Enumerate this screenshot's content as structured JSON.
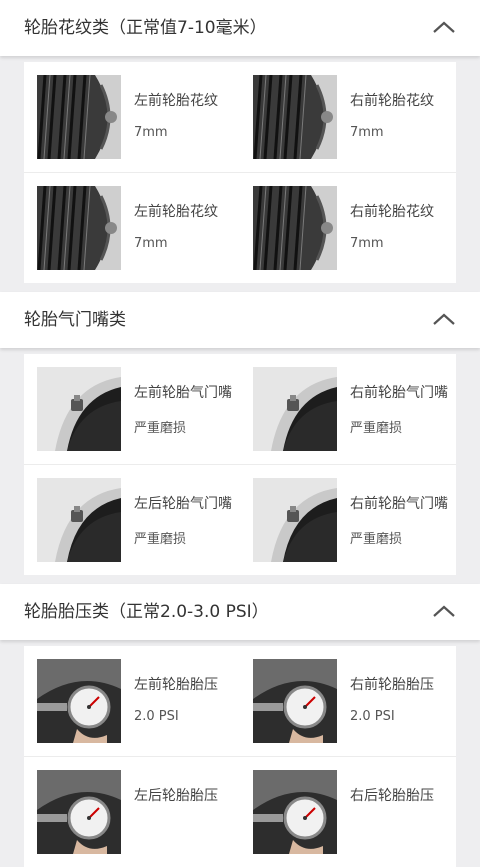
{
  "sections": [
    {
      "title": "轮胎花纹类（正常值7-10毫米）",
      "collapse_icon": "chevron-up-icon",
      "thumb_icon": "tire-tread-image",
      "items": [
        {
          "label": "左前轮胎花纹",
          "value": "7mm"
        },
        {
          "label": "右前轮胎花纹",
          "value": "7mm"
        },
        {
          "label": "左前轮胎花纹",
          "value": "7mm"
        },
        {
          "label": "右前轮胎花纹",
          "value": "7mm"
        }
      ]
    },
    {
      "title": "轮胎气门嘴类",
      "collapse_icon": "chevron-up-icon",
      "thumb_icon": "tire-valve-image",
      "items": [
        {
          "label": "左前轮胎气门嘴",
          "value": "严重磨损"
        },
        {
          "label": "右前轮胎气门嘴",
          "value": "严重磨损"
        },
        {
          "label": "左后轮胎气门嘴",
          "value": "严重磨损"
        },
        {
          "label": "右前轮胎气门嘴",
          "value": "严重磨损"
        }
      ]
    },
    {
      "title": "轮胎胎压类（正常2.0-3.0 PSI）",
      "collapse_icon": "chevron-up-icon",
      "thumb_icon": "tire-pressure-gauge-image",
      "items": [
        {
          "label": "左前轮胎胎压",
          "value": "2.0 PSI"
        },
        {
          "label": "右前轮胎胎压",
          "value": "2.0 PSI"
        },
        {
          "label": "左后轮胎胎压",
          "value": ""
        },
        {
          "label": "右后轮胎胎压",
          "value": ""
        }
      ]
    }
  ],
  "colors": {
    "background": "#eeeef0",
    "card": "#ffffff",
    "text": "#333333"
  }
}
